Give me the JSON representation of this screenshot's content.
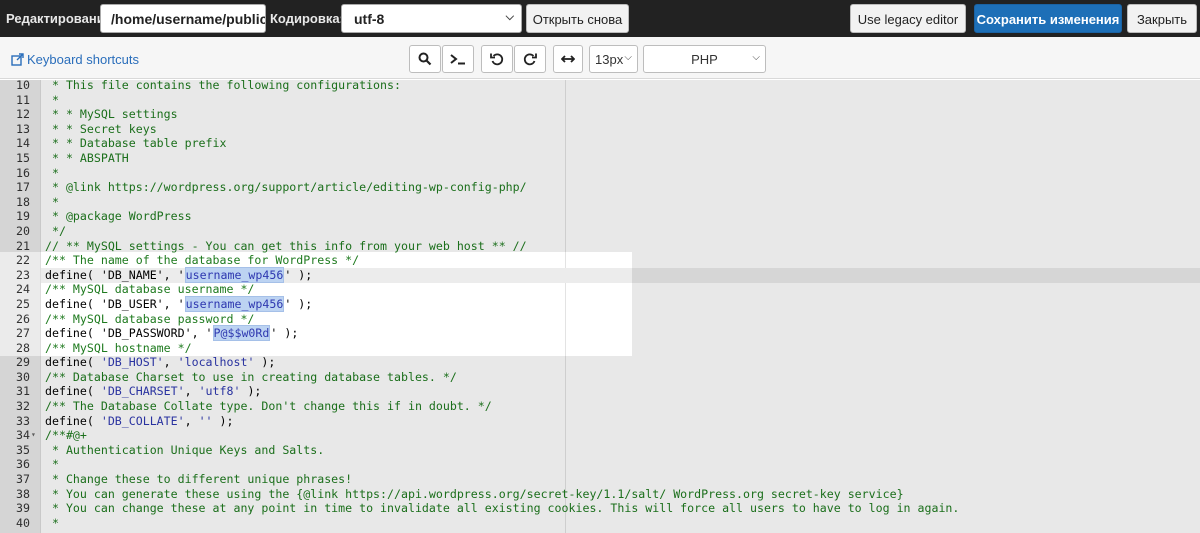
{
  "topbar": {
    "edit_label": "Редактирование:",
    "path_value": "/home/username/public",
    "encoding_label": "Кодировка:",
    "encoding_value": "utf-8",
    "reopen_label": "Открыть снова",
    "legacy_label": "Use legacy editor",
    "save_label": "Сохранить изменения",
    "close_label": "Закрыть"
  },
  "toolbar": {
    "keyboard_shortcuts": "Keyboard shortcuts",
    "font_size": "13px",
    "language": "PHP",
    "icons": [
      "external-link-icon",
      "search-icon",
      "terminal-icon",
      "undo-icon",
      "redo-icon",
      "wrap-icon"
    ]
  },
  "editor": {
    "lines": [
      {
        "num": "10",
        "code": " * This file contains the following configurations:"
      },
      {
        "num": "11",
        "code": " *"
      },
      {
        "num": "12",
        "code": " * * MySQL settings"
      },
      {
        "num": "13",
        "code": " * * Secret keys"
      },
      {
        "num": "14",
        "code": " * * Database table prefix"
      },
      {
        "num": "15",
        "code": " * * ABSPATH"
      },
      {
        "num": "16",
        "code": " *"
      },
      {
        "num": "17",
        "code": " * @link https://wordpress.org/support/article/editing-wp-config-php/"
      },
      {
        "num": "18",
        "code": " *"
      },
      {
        "num": "19",
        "code": " * @package WordPress"
      },
      {
        "num": "20",
        "code": " */"
      },
      {
        "num": "21",
        "code": "// ** MySQL settings - You can get this info from your web host ** //"
      },
      {
        "num": "22",
        "code": "/** The name of the database for WordPress */"
      },
      {
        "num": "23",
        "pre": "define( 'DB_NAME', '",
        "sel": "username_wp456",
        "post": "' );"
      },
      {
        "num": "24",
        "code": "/** MySQL database username */"
      },
      {
        "num": "25",
        "pre": "define( 'DB_USER', '",
        "sel": "username_wp456",
        "post": "' );"
      },
      {
        "num": "26",
        "code": "/** MySQL database password */"
      },
      {
        "num": "27",
        "pre": "define( 'DB_PASSWORD', '",
        "sel": "P@$$w0Rd",
        "post": "' );"
      },
      {
        "num": "28",
        "code": "/** MySQL hostname */"
      },
      {
        "num": "29",
        "code": "define( 'DB_HOST', 'localhost' );"
      },
      {
        "num": "30",
        "code": "/** Database Charset to use in creating database tables. */"
      },
      {
        "num": "31",
        "code": "define( 'DB_CHARSET', 'utf8' );"
      },
      {
        "num": "32",
        "code": "/** The Database Collate type. Don't change this if in doubt. */"
      },
      {
        "num": "33",
        "code": "define( 'DB_COLLATE', '' );"
      },
      {
        "num": "34",
        "code": "/**#@+",
        "fold": true
      },
      {
        "num": "35",
        "code": " * Authentication Unique Keys and Salts."
      },
      {
        "num": "36",
        "code": " *"
      },
      {
        "num": "37",
        "code": " * Change these to different unique phrases!"
      },
      {
        "num": "38",
        "code": " * You can generate these using the {@link https://api.wordpress.org/secret-key/1.1/salt/ WordPress.org secret-key service}"
      },
      {
        "num": "39",
        "code": " * You can change these at any point in time to invalidate all existing cookies. This will force all users to have to log in again."
      },
      {
        "num": "40",
        "code": " *"
      }
    ]
  },
  "colors": {
    "topbar_bg": "#222222",
    "save_button": "#1d6fb7",
    "link": "#2a6ebb",
    "comment": "#1e7a1e",
    "string": "#2e38b0",
    "selection": "#bcd3f2"
  }
}
